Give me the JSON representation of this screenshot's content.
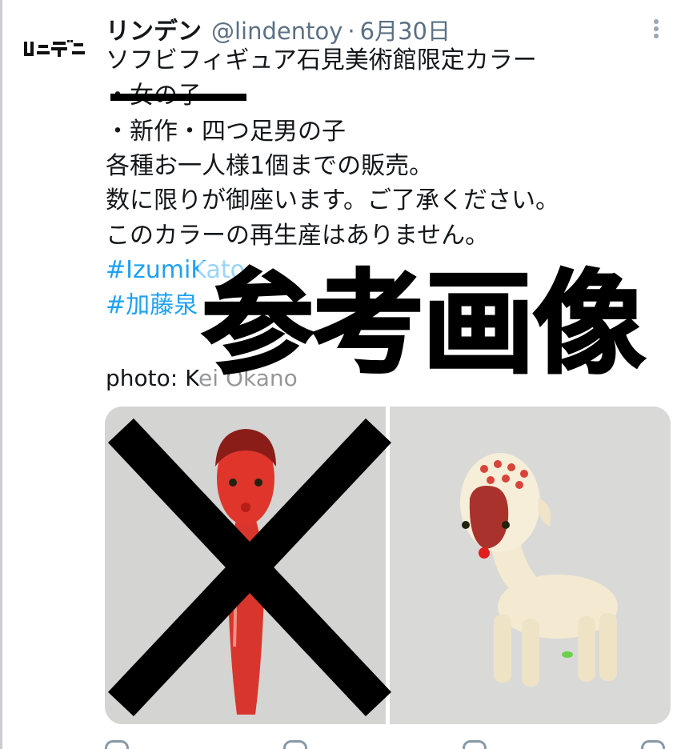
{
  "tweet": {
    "display_name": "リンデン",
    "handle": "@lindentoy",
    "separator": "·",
    "date": "6月30日",
    "avatar_logo_text": "リンデン",
    "lines": [
      "ソフビフィギュア石見美術館限定カラー",
      "・女の子",
      "・新作・四つ足男の子",
      "各種お一人様1個までの販売。",
      "数に限りが御座います。ご了承ください。",
      "このカラーの再生産はありません。"
    ],
    "hashtags": [
      "#IzumiKato",
      "#加藤泉"
    ],
    "photo_credit": "photo: Kei Okano"
  },
  "overlay": {
    "stamp_text": "参考画像"
  },
  "media": {
    "items": [
      {
        "name": "red-figure-photo",
        "description_icon": "red-standing-figure",
        "crossed_out": true
      },
      {
        "name": "cream-figure-photo",
        "description_icon": "cream-four-legged-figure",
        "crossed_out": false
      }
    ]
  },
  "colors": {
    "hashtag": "#1da1f2",
    "secondary_text": "#5b7083",
    "red_figure": "#e0352b",
    "cream_figure": "#f4ead2"
  },
  "actions": [
    "reply-icon",
    "retweet-icon",
    "like-icon",
    "share-icon"
  ]
}
